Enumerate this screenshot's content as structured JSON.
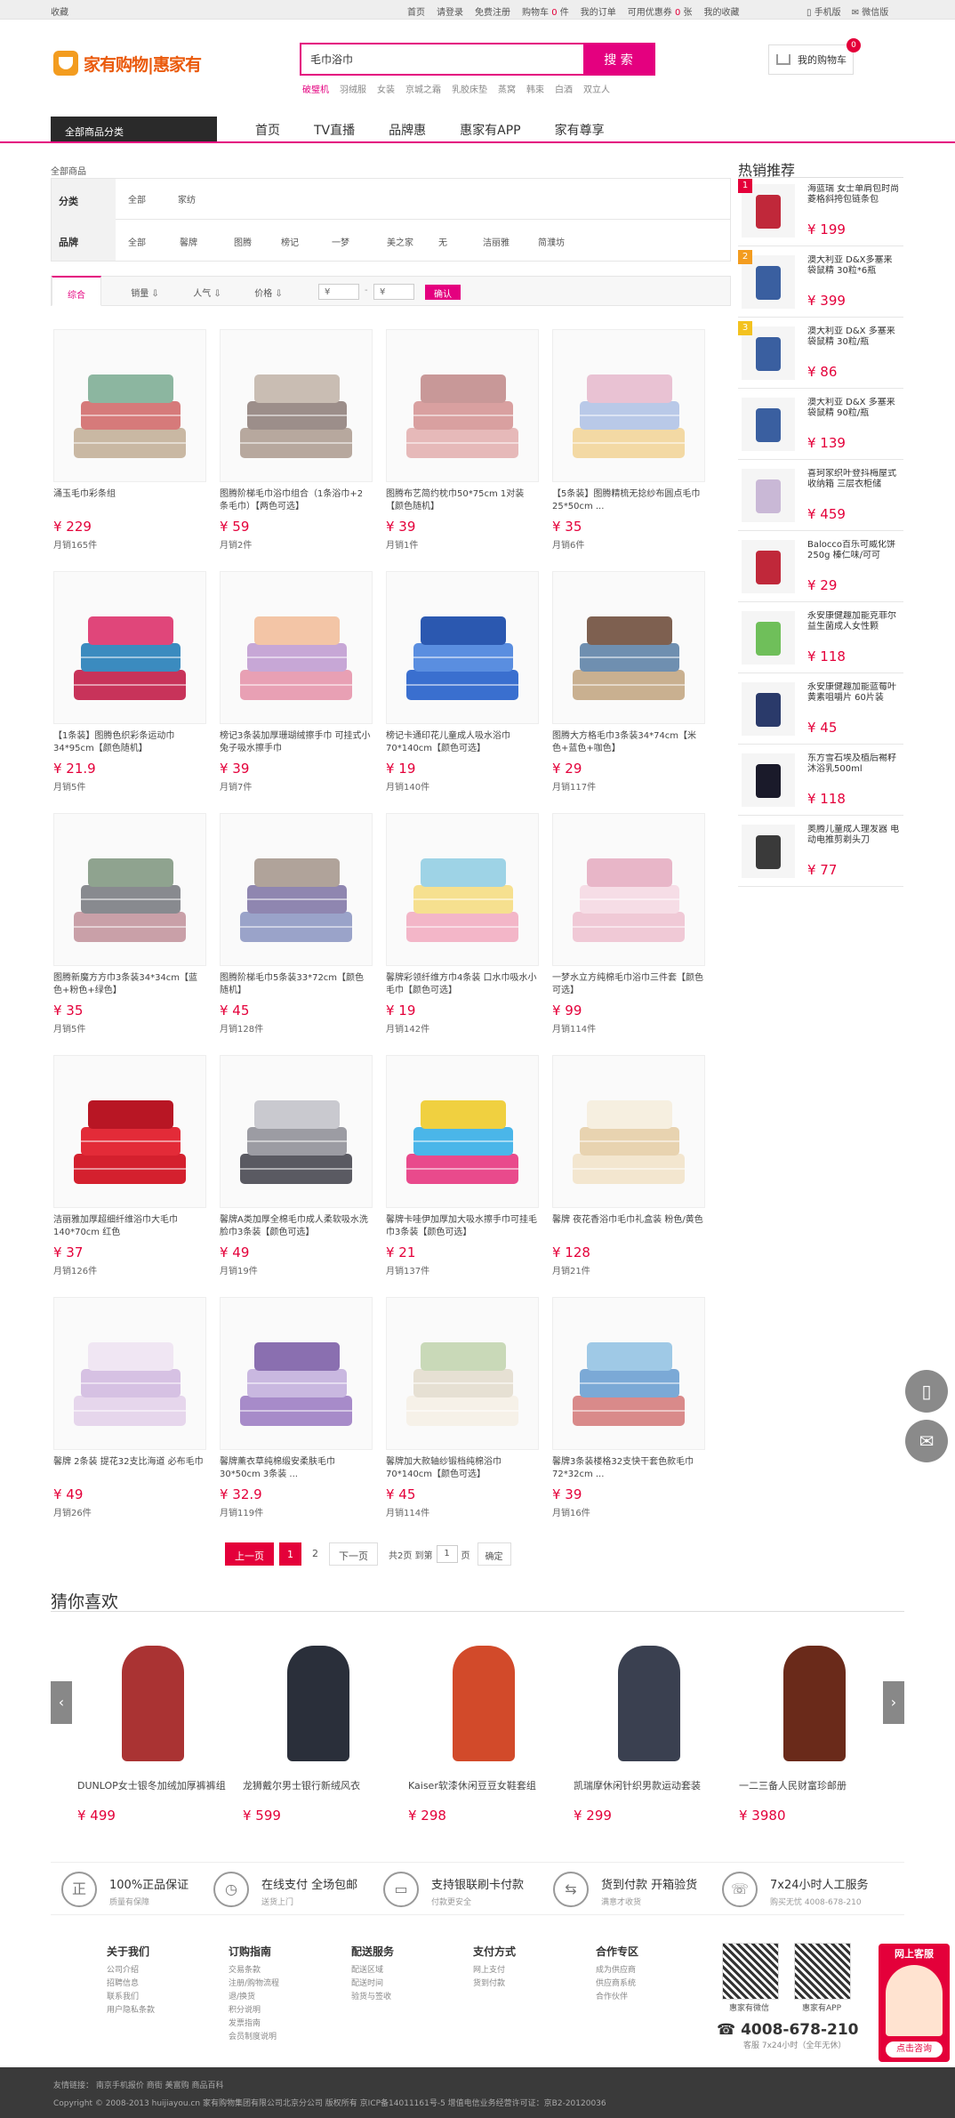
{
  "topbar": {
    "favorite": "收藏",
    "links": [
      "首页",
      "请登录",
      "免费注册",
      "我的订单",
      "可用优惠券",
      "我的收藏"
    ],
    "cart_text": "购物车",
    "cart_count": "0",
    "cart_unit": "件",
    "coupon_count": "0",
    "coupon_unit": "张",
    "mobile": "手机版",
    "wechat": "微信版"
  },
  "header": {
    "logo_text": "家有购物|惠家有",
    "search_value": "毛巾浴巾",
    "search_button": "搜 索",
    "hot_words": [
      "破璧机",
      "羽绒服",
      "女装",
      "京城之霜",
      "乳胶床垫",
      "蒸窝",
      "韩束",
      "白酒",
      "双立人"
    ],
    "cart_label": "我的购物车",
    "cart_badge": "0"
  },
  "nav": {
    "all_categories": "全部商品分类",
    "links": [
      "首页",
      "TV直播",
      "品牌惠",
      "惠家有APP",
      "家有尊享"
    ]
  },
  "filters": {
    "breadcrumb": "全部商品",
    "category_label": "分类",
    "category_options": [
      "全部",
      "家纺"
    ],
    "brand_label": "品牌",
    "brand_options": [
      "全部",
      "馨牌",
      "图腾",
      "榜记",
      "一梦",
      "美之家",
      "无",
      "洁丽雅",
      "简濮坊"
    ]
  },
  "sort": {
    "tabs": [
      "综合",
      "销量 ⇩",
      "人气 ⇩",
      "价格 ⇩"
    ],
    "price_from": "¥",
    "price_to": "¥",
    "dash": "-",
    "confirm": "确认"
  },
  "products": [
    {
      "name": "涌玉毛巾彩条组",
      "price": "¥ 229",
      "sales": "月销165件",
      "colors": [
        "#c9b8a3",
        "#d67a7a",
        "#8cb6a0"
      ]
    },
    {
      "name": "图腾阶梯毛巾浴巾组合（1条浴巾+2条毛巾）【两色可选】",
      "price": "¥ 59",
      "sales": "月销2件",
      "colors": [
        "#b7a89e",
        "#9c8e8a",
        "#c9bdb3"
      ]
    },
    {
      "name": "图腾布艺简约枕巾50*75cm 1对装【颜色随机】",
      "price": "¥ 39",
      "sales": "月销1件",
      "colors": [
        "#e6b9b9",
        "#d9a0a0",
        "#c89898"
      ]
    },
    {
      "name": "【5条装】图腾精梳无捻纱布圆点毛巾25*50cm ...",
      "price": "¥ 35",
      "sales": "月销6件",
      "colors": [
        "#f3d9a4",
        "#b9c9e8",
        "#e9c2d3"
      ]
    },
    {
      "name": "【1条装】图腾色织彩条运动巾34*95cm【颜色随机】",
      "price": "¥ 21.9",
      "sales": "月销5件",
      "colors": [
        "#c8335a",
        "#3b8bbf",
        "#e0467a"
      ]
    },
    {
      "name": "榜记3条装加厚珊瑚绒擦手巾 可挂式小兔子吸水擦手巾",
      "price": "¥ 39",
      "sales": "月销7件",
      "colors": [
        "#e8a0b4",
        "#c7a7d6",
        "#f3c5a6"
      ]
    },
    {
      "name": "榜记卡通印花儿童成人吸水浴巾70*140cm【颜色可选】",
      "price": "¥ 19",
      "sales": "月销140件",
      "colors": [
        "#3a6fcf",
        "#5a8ee0",
        "#2b58b0"
      ]
    },
    {
      "name": "图腾大方格毛巾3条装34*74cm【米色+蓝色+咖色】",
      "price": "¥ 29",
      "sales": "月销117件",
      "colors": [
        "#c9b090",
        "#6f8fb0",
        "#7e6050"
      ]
    },
    {
      "name": "图腾新魔方方巾3条装34*34cm【蓝色+粉色+绿色】",
      "price": "¥ 35",
      "sales": "月销5件",
      "colors": [
        "#c9a0a8",
        "#888a8f",
        "#8fa38f"
      ]
    },
    {
      "name": "图腾阶梯毛巾5条装33*72cm【颜色随机】",
      "price": "¥ 45",
      "sales": "月销128件",
      "colors": [
        "#9aa3c9",
        "#8f86b0",
        "#b0a39a"
      ]
    },
    {
      "name": "馨牌彩领纤维方巾4条装 口水巾吸水小毛巾【颜色可选】",
      "price": "¥ 19",
      "sales": "月销142件",
      "colors": [
        "#f3b6c8",
        "#f6e08f",
        "#9ed3e6"
      ]
    },
    {
      "name": "一梦水立方纯棉毛巾浴巾三件套【颜色可选】",
      "price": "¥ 99",
      "sales": "月销114件",
      "colors": [
        "#f0c9d6",
        "#f6dde6",
        "#e8b6c8"
      ]
    },
    {
      "name": "洁丽雅加厚超细纤维浴巾大毛巾140*70cm 红色",
      "price": "¥ 37",
      "sales": "月销126件",
      "colors": [
        "#d4202e",
        "#e32b38",
        "#b81624"
      ]
    },
    {
      "name": "馨牌A类加厚全棉毛巾成人柔软吸水洗脸巾3条装【颜色可选】",
      "price": "¥ 49",
      "sales": "月销19件",
      "colors": [
        "#5a5a62",
        "#9c9ca3",
        "#c9c9cf"
      ]
    },
    {
      "name": "馨牌卡哇伊加厚加大吸水擦手巾可挂毛巾3条装【颜色可选】",
      "price": "¥ 21",
      "sales": "月销137件",
      "colors": [
        "#e94a8c",
        "#4ab6e9",
        "#f0d040"
      ]
    },
    {
      "name": "馨牌 夜花香浴巾毛巾礼盒装 粉色/黄色",
      "price": "¥ 128",
      "sales": "月销21件",
      "colors": [
        "#f3e6cf",
        "#e8d3b0",
        "#f6efe0"
      ]
    },
    {
      "name": "馨牌 2条装 提花32支比海道 必布毛巾",
      "price": "¥ 49",
      "sales": "月销26件",
      "colors": [
        "#e6d6ec",
        "#d6c1e3",
        "#f0e6f3"
      ]
    },
    {
      "name": "馨牌薰衣草纯棉缎安柔肤毛巾30*50cm 3条装 ...",
      "price": "¥ 32.9",
      "sales": "月销119件",
      "colors": [
        "#a78bc9",
        "#c9b8e0",
        "#8a6fb0"
      ]
    },
    {
      "name": "馨牌加大款轴纱锻档纯棉浴巾70*140cm【颜色可选】",
      "price": "¥ 45",
      "sales": "月销114件",
      "colors": [
        "#f6f1e8",
        "#e6e0d3",
        "#c9d9b8"
      ]
    },
    {
      "name": "馨牌3条装楼格32支快干套色款毛巾72*32cm ...",
      "price": "¥ 39",
      "sales": "月销16件",
      "colors": [
        "#d98a8a",
        "#7ba9d6",
        "#9fc9e6"
      ]
    }
  ],
  "hot": {
    "title": "热销推荐",
    "items": [
      {
        "rank": "1",
        "name": "海蓝瑞 女士单肩包时尚菱格斜挎包链条包",
        "price": "¥ 199",
        "color": "#c0283a"
      },
      {
        "rank": "2",
        "name": "澳大利亚 D&X多塞来袋鼠精 30粒*6瓶",
        "price": "¥ 399",
        "color": "#3a5fa0"
      },
      {
        "rank": "3",
        "name": "澳大利亚 D&X 多塞来 袋鼠精 30粒/瓶",
        "price": "¥ 86",
        "color": "#3a5fa0"
      },
      {
        "rank": "",
        "name": "澳大利亚 D&X 多塞来 袋鼠精 90粒/瓶",
        "price": "¥ 139",
        "color": "#3a5fa0"
      },
      {
        "rank": "",
        "name": "喜珂家织叶登抖梅屋式收纳箱 三层衣柜储",
        "price": "¥ 459",
        "color": "#c9b8d6"
      },
      {
        "rank": "",
        "name": "Balocco百乐可威化饼250g 榛仁味/可可",
        "price": "¥ 29",
        "color": "#c0283a"
      },
      {
        "rank": "",
        "name": "永安康健趣加能克菲尔益生菌成人女性颗",
        "price": "¥ 118",
        "color": "#6fbf5a"
      },
      {
        "rank": "",
        "name": "永安康健趣加能蓝莓叶黄素咀嚼片 60片装",
        "price": "¥ 45",
        "color": "#2a3a6a"
      },
      {
        "rank": "",
        "name": "东方雪石埃及植后裼籽沐浴乳500ml",
        "price": "¥ 118",
        "color": "#1a1a2a"
      },
      {
        "rank": "",
        "name": "奥腾儿童成人理发器 电动电推剪剃头刀",
        "price": "¥ 77",
        "color": "#3a3a3a"
      }
    ]
  },
  "pager": {
    "prev": "上一页",
    "pages": [
      "1",
      "2"
    ],
    "next": "下一页",
    "total": "共2页 到第",
    "page_input": "1",
    "page_unit": "页",
    "go": "确定"
  },
  "guess": {
    "title": "猜你喜欢",
    "prev_arrow": "‹",
    "next_arrow": "›",
    "items": [
      {
        "name": "DUNLOP女士银冬加绒加厚裤裤组",
        "price": "¥ 499",
        "color": "#a33"
      },
      {
        "name": "龙狮戴尔男士银行新绒风衣",
        "price": "¥ 599",
        "color": "#2a2f3a"
      },
      {
        "name": "Kaiser软漆休闲豆豆女鞋套组",
        "price": "¥ 298",
        "color": "#d24a2a"
      },
      {
        "name": "凯瑞摩休闲针织男款运动套装",
        "price": "¥ 299",
        "color": "#3a4050"
      },
      {
        "name": "一二三备人民财富珍邮册",
        "price": "¥ 3980",
        "color": "#6a2a1a"
      }
    ]
  },
  "services": [
    {
      "icon": "正",
      "title": "100%正品保证",
      "sub": "质量有保障"
    },
    {
      "icon": "◷",
      "title": "在线支付 全场包邮",
      "sub": "送货上门"
    },
    {
      "icon": "▭",
      "title": "支持银联刷卡付款",
      "sub": "付款更安全"
    },
    {
      "icon": "⇆",
      "title": "货到付款 开箱验货",
      "sub": "满意才收货"
    },
    {
      "icon": "☏",
      "title": "7x24小时人工服务",
      "sub": "购买无忧 4008-678-210"
    }
  ],
  "footer": {
    "columns": [
      {
        "title": "关于我们",
        "links": [
          "公司介绍",
          "招聘信息",
          "联系我们",
          "用户隐私条款"
        ]
      },
      {
        "title": "订购指南",
        "links": [
          "交易条款",
          "注册/购物流程",
          "退/换货",
          "积分说明",
          "发票指南",
          "会员制度说明"
        ]
      },
      {
        "title": "配送服务",
        "links": [
          "配送区域",
          "配送时间",
          "验货与签收"
        ]
      },
      {
        "title": "支付方式",
        "links": [
          "网上支付",
          "货到付款"
        ]
      },
      {
        "title": "合作专区",
        "links": [
          "成为供应商",
          "供应商系统",
          "合作伙伴"
        ]
      }
    ],
    "qr1_label": "惠家有微信",
    "qr2_label": "惠家有APP",
    "phone": "4008-678-210",
    "phone_note": "客服 7x24小时（全年无休）",
    "links_line": "友情链接：  南京手机报价  商街  美富购  商品百科",
    "copyright": "Copyright © 2008-2013 huijiayou.cn 家有购物集团有限公司北京分公司 版权所有 京ICP备14011161号-5 增值电信业务经营许可证：京B2-20120036"
  },
  "floating": {
    "kefu_title": "网上客服",
    "kefu_button": "点击咨询",
    "phone_icon": "▯",
    "wechat_icon": "✉"
  }
}
